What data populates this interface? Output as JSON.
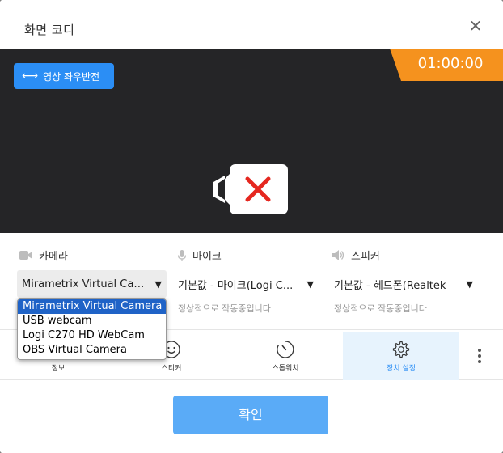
{
  "dialog": {
    "title": "화면 코디",
    "close_icon": "close-icon"
  },
  "preview": {
    "flip_button_label": "영상 좌우반전",
    "timer": "01:00:00",
    "background": "#252527",
    "timer_color": "#f5921e",
    "camera_status_icon": "camera-off-icon"
  },
  "camera": {
    "label": "카메라",
    "icon": "camera-icon",
    "selected": "Mirametrix Virtual Cam...",
    "options": [
      "Mirametrix Virtual Camera",
      "USB webcam",
      "Logi C270 HD WebCam",
      "OBS Virtual Camera"
    ]
  },
  "mic": {
    "label": "마이크",
    "icon": "mic-icon",
    "selected": "기본값 - 마이크(Logi C...",
    "status": "정상적으로 작동중입니다"
  },
  "speaker": {
    "label": "스피커",
    "icon": "speaker-icon",
    "selected": "기본값 - 헤드폰(Realtek",
    "status": "정상적으로 작동중입니다"
  },
  "tabs": [
    {
      "label": "정보",
      "icon": "info-icon"
    },
    {
      "label": "스티커",
      "icon": "smiley-icon"
    },
    {
      "label": "스톱워치",
      "icon": "stopwatch-icon"
    },
    {
      "label": "장치 설정",
      "icon": "gear-icon",
      "active": true
    }
  ],
  "more_icon": "more-vertical-icon",
  "confirm_label": "확인",
  "accent_color": "#2b8ef5"
}
